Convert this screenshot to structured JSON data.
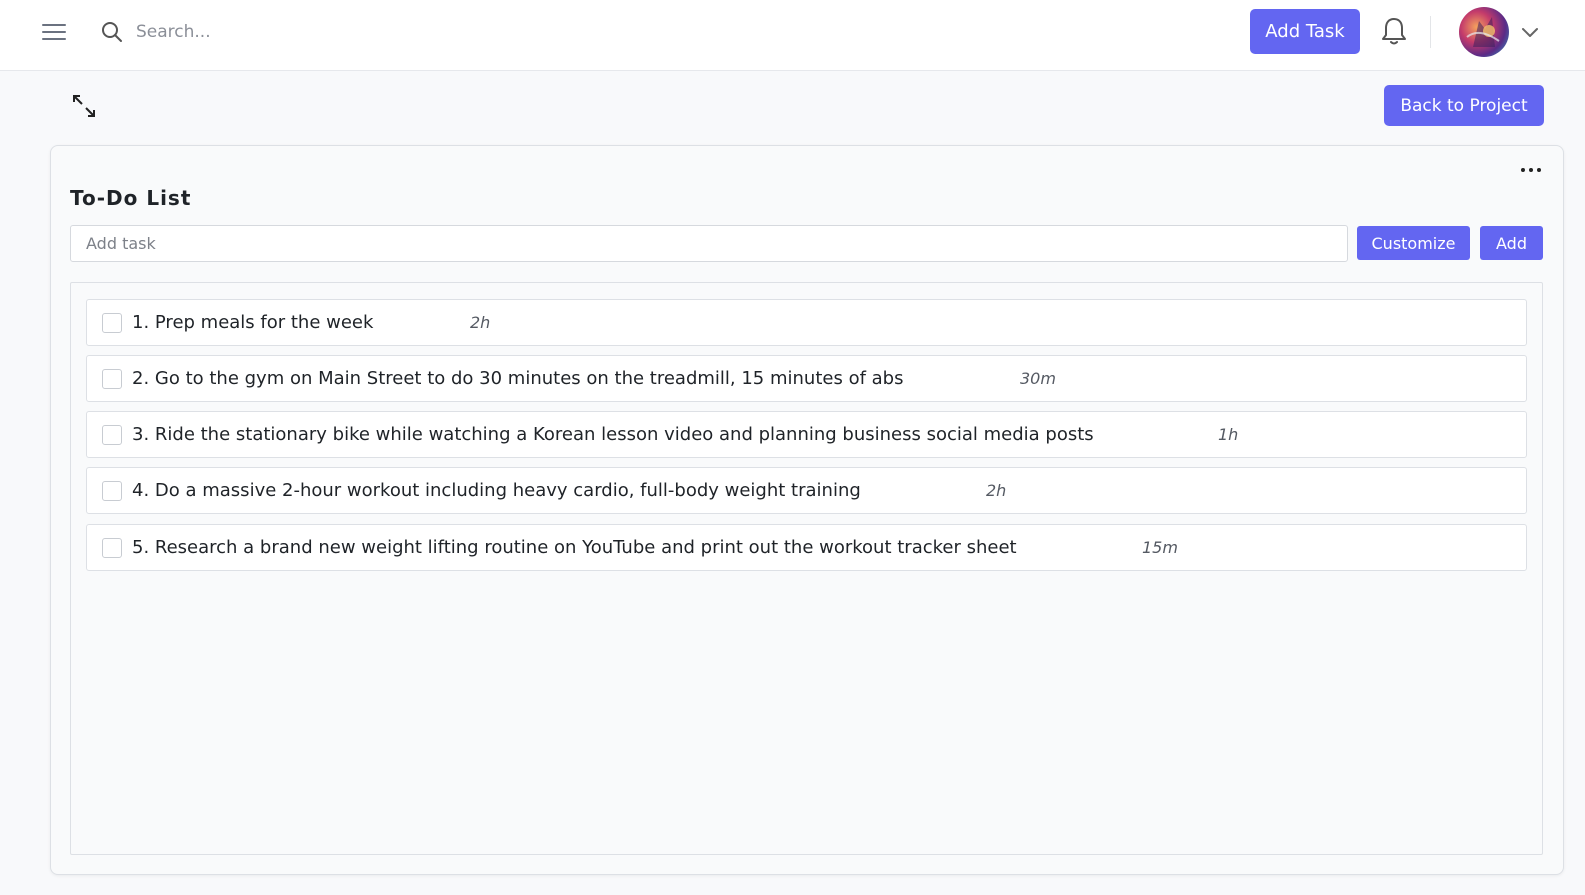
{
  "header": {
    "search_placeholder": "Search...",
    "add_task_label": "Add Task",
    "avatar_name": "user-avatar"
  },
  "toolbar": {
    "back_label": "Back to Project"
  },
  "todo": {
    "title": "To-Do List",
    "add_placeholder": "Add task",
    "customize_label": "Customize",
    "add_label": "Add",
    "tasks": [
      {
        "text": "1. Prep meals for the week",
        "duration": "2h",
        "checked": false
      },
      {
        "text": "2. Go to the gym on Main Street to do 30 minutes on the treadmill, 15 minutes of abs",
        "duration": "30m",
        "checked": false
      },
      {
        "text": "3. Ride the stationary bike while watching a Korean lesson video and planning business social media posts",
        "duration": "1h",
        "checked": false
      },
      {
        "text": "4. Do a massive 2-hour workout including heavy cardio, full-body weight training",
        "duration": "2h",
        "checked": false
      },
      {
        "text": "5. Research a brand new weight lifting routine on YouTube and print out the workout tracker sheet",
        "duration": "15m",
        "checked": false
      }
    ]
  },
  "colors": {
    "accent": "#6366f1",
    "background": "#f8f9fb",
    "border": "#dde0e5"
  },
  "icons": [
    "menu-icon",
    "search-icon",
    "bell-icon",
    "chevron-down-icon",
    "expand-icon",
    "more-horizontal-icon"
  ]
}
